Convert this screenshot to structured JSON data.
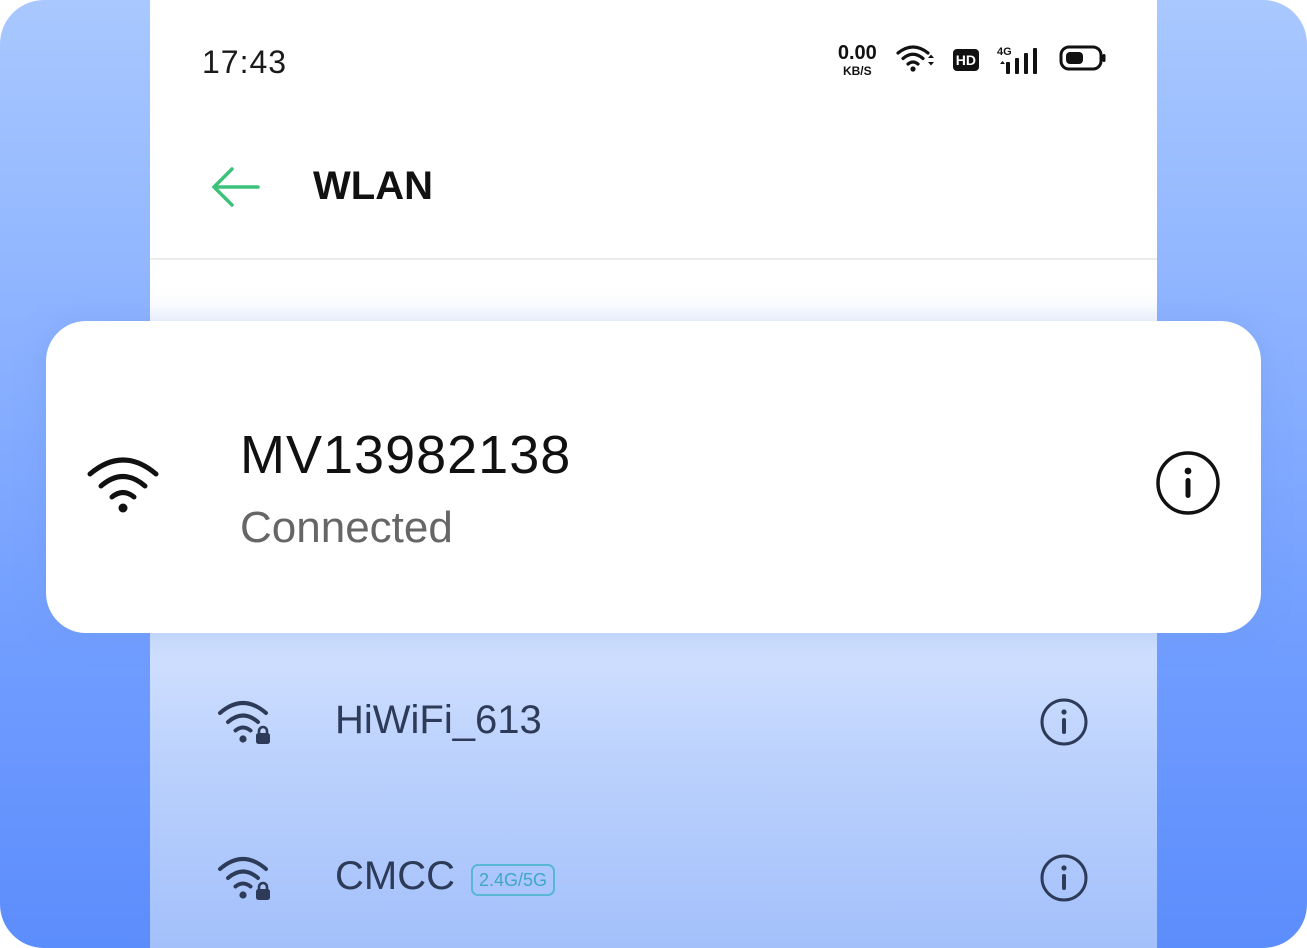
{
  "status_bar": {
    "time": "17:43",
    "net_speed_value": "0.00",
    "net_speed_unit": "KB/S",
    "hd_label": "HD",
    "network_type": "4G",
    "icons": [
      "wifi-icon",
      "hd-icon",
      "signal-4g-icon",
      "battery-icon"
    ]
  },
  "header": {
    "title": "WLAN",
    "back_icon": "back-arrow-icon"
  },
  "connected_network": {
    "ssid": "MV13982138",
    "status": "Connected",
    "icon": "wifi-icon",
    "info_icon": "info-icon"
  },
  "networks": [
    {
      "ssid": "HiWiFi_613",
      "band": "",
      "secured": true
    },
    {
      "ssid": "CMCC",
      "band": "2.4G/5G",
      "secured": true
    }
  ],
  "colors": {
    "accent": "#3cc27a",
    "background_top": "#a9c8ff",
    "background_bottom": "#5c8dfc",
    "list_text": "#2d3b58",
    "band_badge": "#3fa7c7"
  }
}
